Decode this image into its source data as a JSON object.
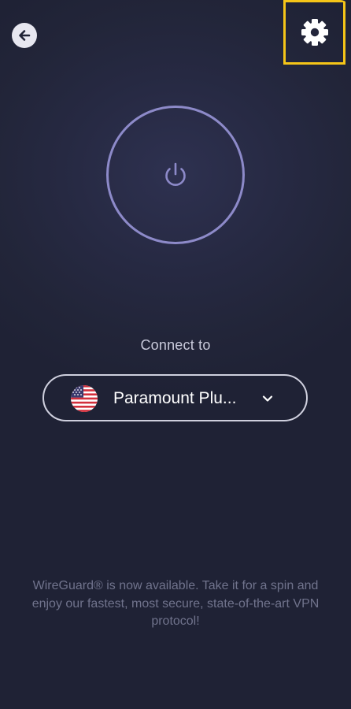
{
  "header": {
    "back_icon": "arrow-left-icon",
    "settings_icon": "gear-icon"
  },
  "power": {
    "icon": "power-icon",
    "ring_color": "#8d8ac9"
  },
  "connect": {
    "label": "Connect to",
    "location": "Paramount Plu...",
    "flag_icon": "us-flag-icon",
    "dropdown_icon": "chevron-down-icon"
  },
  "footer": {
    "message": "WireGuard® is now available. Take it for a spin and enjoy our fastest, most secure, state-of-the-art VPN protocol!"
  },
  "colors": {
    "background": "#1f2235",
    "highlight": "#f5c518",
    "accent": "#8d8ac9"
  }
}
